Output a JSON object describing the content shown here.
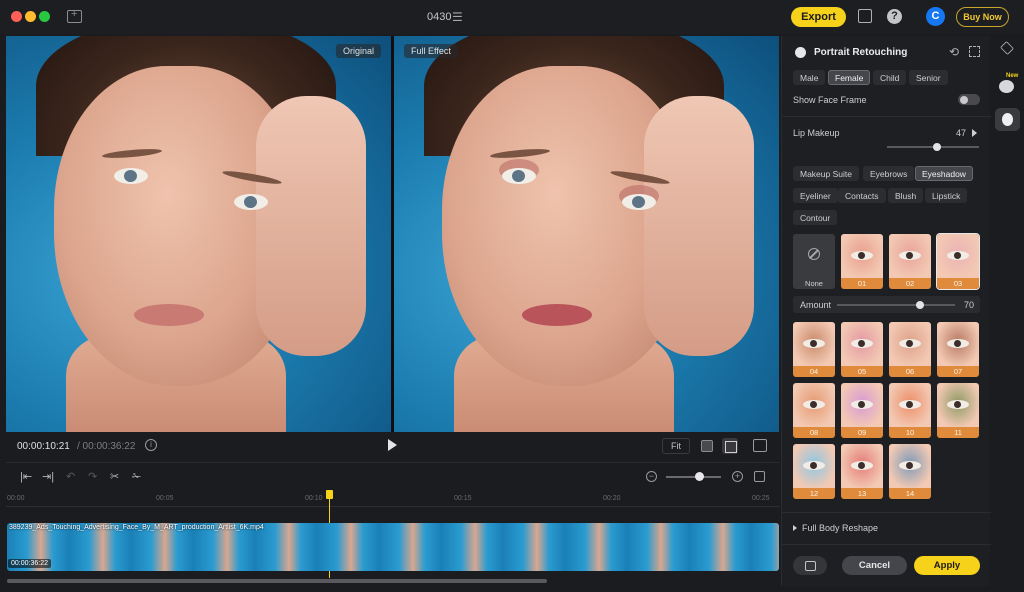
{
  "window": {
    "title": "0430"
  },
  "toolbar": {
    "export_label": "Export",
    "user_initial": "C",
    "buy_label": "Buy Now",
    "help_glyph": "?"
  },
  "preview": {
    "original_label": "Original",
    "effect_label": "Full Effect"
  },
  "playback": {
    "current_time": "00:00:10:21",
    "total_time": "/ 00:00:36:22",
    "fit_label": "Fit"
  },
  "timeline": {
    "ticks": [
      "00:00",
      "00:05",
      "00:10",
      "00:15",
      "00:20",
      "00:25"
    ],
    "clip_name": "389239_Ads_Touching_Advertising_Face_By_M_ART_production_Artlist_6K.mp4",
    "clip_duration": "00:00:36:22"
  },
  "panel": {
    "title": "Portrait Retouching",
    "genders": [
      "Male",
      "Female",
      "Child",
      "Senior"
    ],
    "active_gender": "Female",
    "face_frame_label": "Show Face Frame",
    "lip_label": "Lip Makeup",
    "lip_value": "47",
    "lip_level": 0.47,
    "categories": [
      "Makeup Suite",
      "Eyebrows",
      "Eyeshadow",
      "Eyeliner",
      "Contacts",
      "Blush",
      "Lipstick",
      "Contour"
    ],
    "active_category": "Eyeshadow",
    "none_label": "None",
    "amount_label": "Amount",
    "amount_value": "70",
    "amount_level": 0.7,
    "presets": [
      "01",
      "02",
      "03",
      "04",
      "05",
      "06",
      "07",
      "08",
      "09",
      "10",
      "11",
      "12",
      "13",
      "14"
    ],
    "selected_preset": "03",
    "preset_colors": [
      "#e8a08e",
      "#e8a49a",
      "#eab3b4",
      "#c98b6c",
      "#e49aa3",
      "#dea28a",
      "#b77a64",
      "#e59a72",
      "#d89bd3",
      "#ec8f6a",
      "#8f9a66",
      "#8fc7e4",
      "#e47d78",
      "#7f9ab8"
    ],
    "body_reshape_label": "Full Body Reshape",
    "cancel_label": "Cancel",
    "apply_label": "Apply"
  },
  "rail": {
    "new_badge": "New"
  }
}
